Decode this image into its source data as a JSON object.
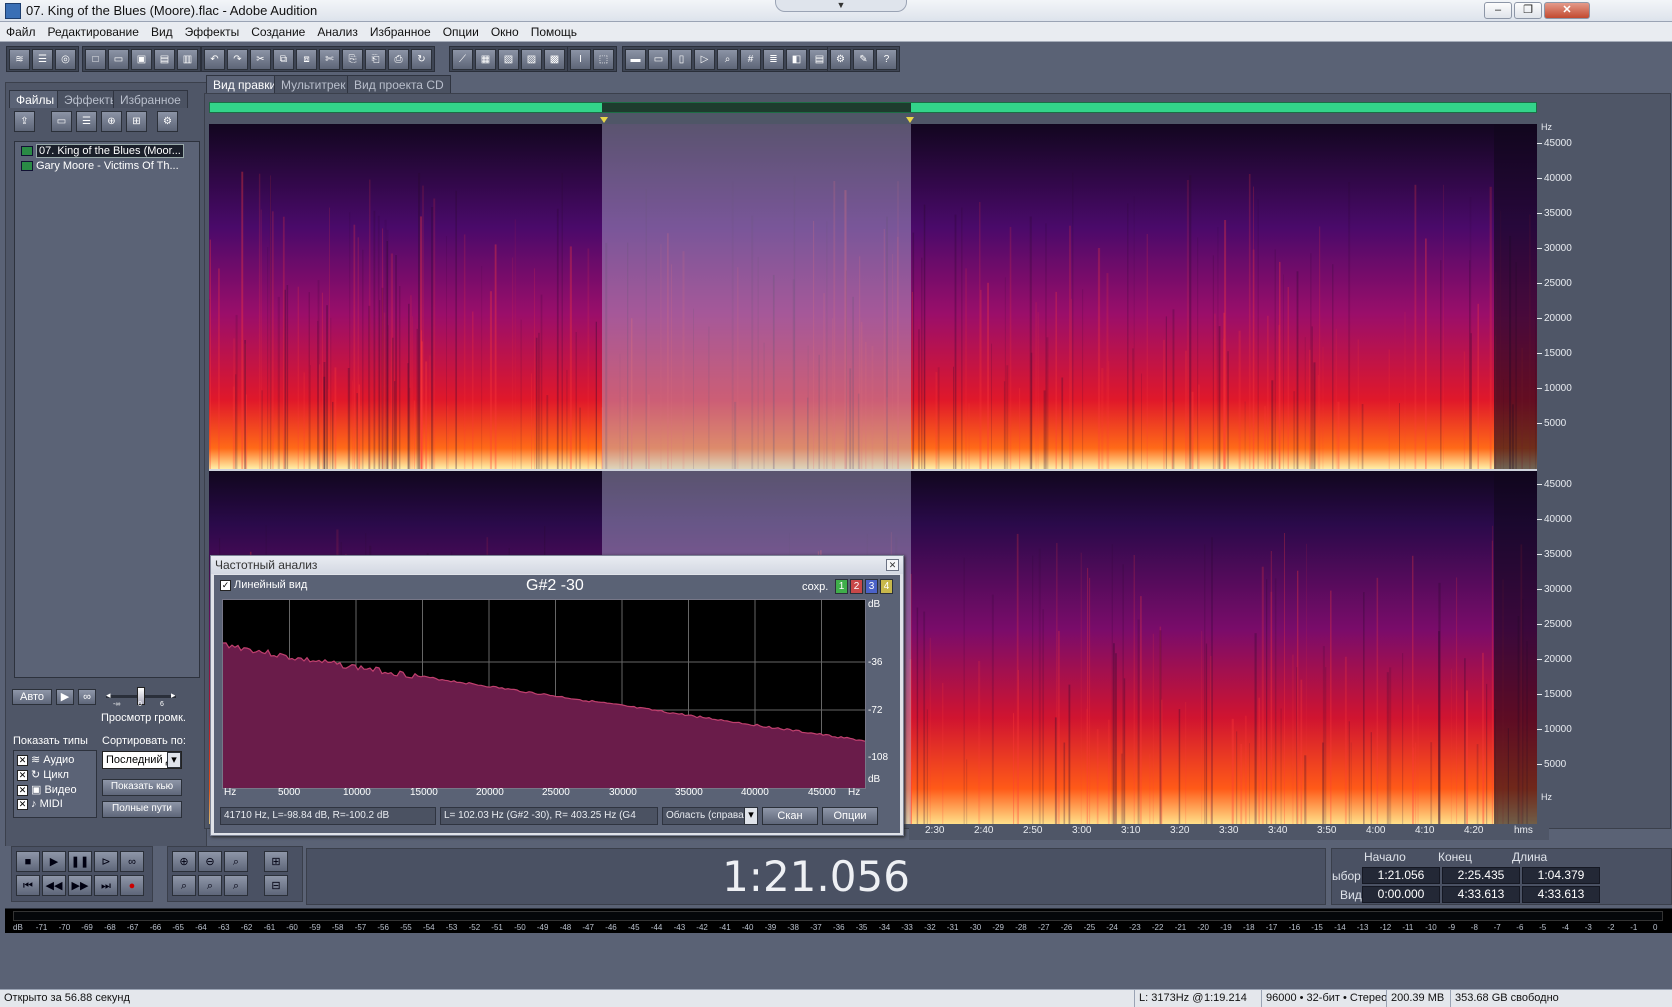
{
  "window": {
    "title": "07. King of the Blues (Moore).flac - Adobe Audition",
    "buttons": {
      "minimize": "‒",
      "maximize": "❐",
      "close": "✕"
    }
  },
  "menu": [
    "Файл",
    "Редактирование",
    "Вид",
    "Эффекты",
    "Создание",
    "Анализ",
    "Избранное",
    "Опции",
    "Окно",
    "Помощь"
  ],
  "left_panel": {
    "tabs": [
      "Файлы",
      "Эффекты",
      "Избранное"
    ],
    "files": [
      "07. King of the Blues (Moor...",
      "Gary Moore - Victims Of Th..."
    ],
    "auto_button": "Авто",
    "preview_volume_label": "Просмотр громк.",
    "slider_ticks": [
      "-∞",
      "0",
      "6"
    ],
    "show_types_label": "Показать типы",
    "show_types": [
      {
        "label": "Аудио",
        "checked": true
      },
      {
        "label": "Цикл",
        "checked": true
      },
      {
        "label": "Видео",
        "checked": true
      },
      {
        "label": "MIDI",
        "checked": true
      }
    ],
    "sort_label": "Сортировать по:",
    "sort_value": "Последний д",
    "show_cue_button": "Показать кью",
    "full_paths_button": "Полные пути"
  },
  "view_tabs": [
    "Вид правки",
    "Мультитрек",
    "Вид проекта CD"
  ],
  "spectrogram": {
    "freq_unit": "Hz",
    "freq_ticks_top": [
      "45000",
      "40000",
      "35000",
      "30000",
      "25000",
      "20000",
      "15000",
      "10000",
      "5000"
    ],
    "freq_ticks_bottom": [
      "45000",
      "40000",
      "35000",
      "30000",
      "25000",
      "20000",
      "15000",
      "10000",
      "5000"
    ],
    "freq_unit_bottom": "Hz",
    "time_ticks": [
      "2:30",
      "2:40",
      "2:50",
      "3:00",
      "3:10",
      "3:20",
      "3:30",
      "3:40",
      "3:50",
      "4:00",
      "4:10",
      "4:20"
    ],
    "time_unit": "hms"
  },
  "frequency_analysis": {
    "title": "Частотный анализ",
    "linear_view_label": "Линейный вид",
    "linear_view_checked": true,
    "note": "G#2 -30",
    "save_label": "сохр.",
    "save_slots": [
      "1",
      "2",
      "3",
      "4"
    ],
    "slot_colors": [
      "#3fae4a",
      "#c84848",
      "#4b62c8",
      "#c8b84b"
    ],
    "x_ticks": [
      "Hz",
      "5000",
      "10000",
      "15000",
      "20000",
      "25000",
      "30000",
      "35000",
      "40000",
      "45000",
      "Hz"
    ],
    "y_ticks": [
      "dB",
      "-36",
      "-72",
      "-108",
      "dB"
    ],
    "readout_cursor": "41710 Hz, L=-98.84 dB, R=-100.2 dB",
    "readout_peak": "L= 102.03 Hz (G#2 -30), R= 403.25 Hz (G4",
    "region_select": "Область (справа се",
    "scan_button": "Скан",
    "options_button": "Опции",
    "fill_color": "#6a1c4a",
    "line_color": "#c0406e"
  },
  "transport": {
    "time": "1:21.056",
    "columns": [
      "Начало",
      "Конец",
      "Длина"
    ],
    "selection_label": "ыбор",
    "view_label": "Вид",
    "selection": [
      "1:21.056",
      "2:25.435",
      "1:04.379"
    ],
    "view": [
      "0:00.000",
      "4:33.613",
      "4:33.613"
    ]
  },
  "level_meter_ticks": [
    "dB",
    "-71",
    "-70",
    "-69",
    "-68",
    "-67",
    "-66",
    "-65",
    "-64",
    "-63",
    "-62",
    "-61",
    "-60",
    "-59",
    "-58",
    "-57",
    "-56",
    "-55",
    "-54",
    "-53",
    "-52",
    "-51",
    "-50",
    "-49",
    "-48",
    "-47",
    "-46",
    "-45",
    "-44",
    "-43",
    "-42",
    "-41",
    "-40",
    "-39",
    "-38",
    "-37",
    "-36",
    "-35",
    "-34",
    "-33",
    "-32",
    "-31",
    "-30",
    "-29",
    "-28",
    "-27",
    "-26",
    "-25",
    "-24",
    "-23",
    "-22",
    "-21",
    "-20",
    "-19",
    "-18",
    "-17",
    "-16",
    "-15",
    "-14",
    "-13",
    "-12",
    "-11",
    "-10",
    "-9",
    "-8",
    "-7",
    "-6",
    "-5",
    "-4",
    "-3",
    "-2",
    "-1",
    "0"
  ],
  "status": {
    "opened": "Открыто за 56.88 секунд",
    "cursor": "L: 3173Hz @",
    "cursor_time": "1:19.214",
    "format": "96000 • 32-бит • Стерео",
    "size": "200.39 MB",
    "free": "353.68 GB свободно"
  }
}
